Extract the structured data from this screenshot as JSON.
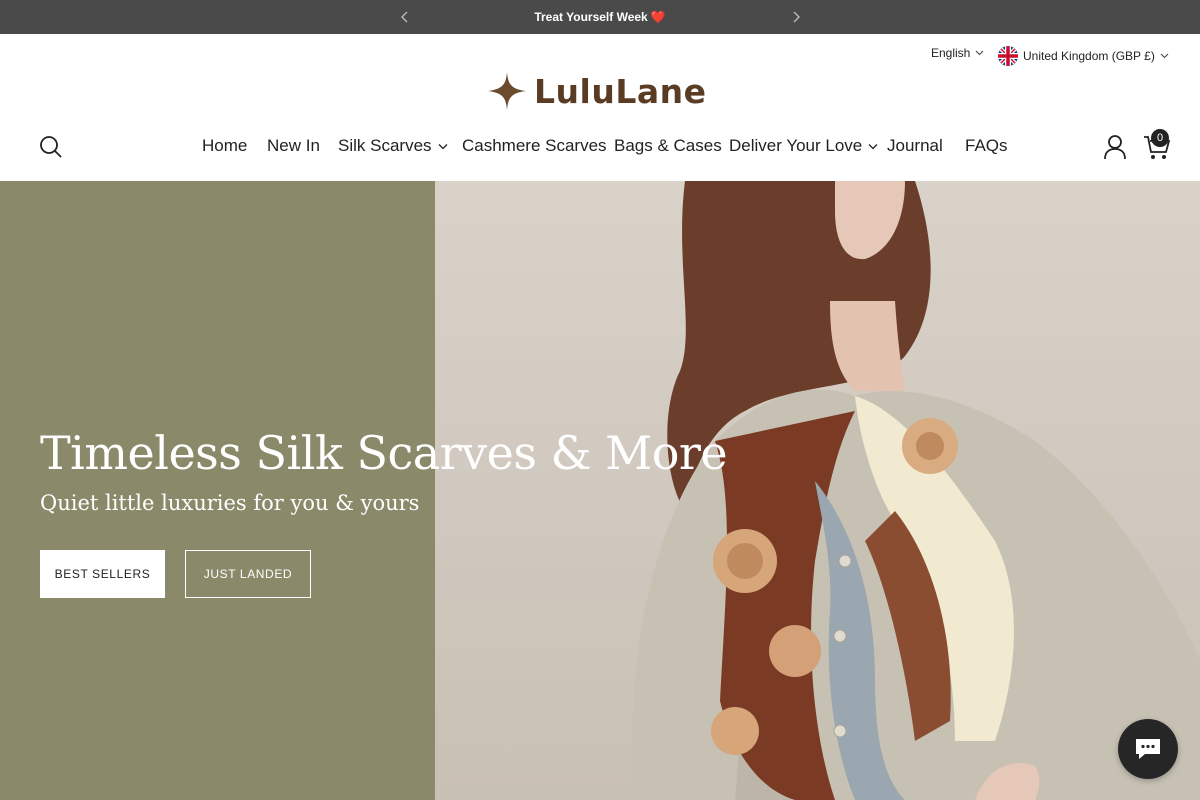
{
  "announcement": {
    "text": "Treat Yourself Week",
    "emoji": "❤️",
    "background": "#4a4a4a"
  },
  "header": {
    "language": "English",
    "country": "United Kingdom (GBP £)",
    "logo_text": "LuluLane",
    "logo_color": "#5a3c25",
    "cart_count": "0"
  },
  "nav": {
    "items": [
      {
        "label": "Home",
        "has_dropdown": false
      },
      {
        "label": "New In",
        "has_dropdown": false
      },
      {
        "label": "Silk Scarves",
        "has_dropdown": true
      },
      {
        "label": "Cashmere Scarves",
        "has_dropdown": false
      },
      {
        "label": "Bags & Cases",
        "has_dropdown": false
      },
      {
        "label": "Deliver Your Love",
        "has_dropdown": true
      },
      {
        "label": "Journal",
        "has_dropdown": false
      },
      {
        "label": "FAQs",
        "has_dropdown": false
      }
    ]
  },
  "hero": {
    "title": "Timeless Silk Scarves & More",
    "subtitle": "Quiet little luxuries for you & yours",
    "primary_button": "BEST SELLERS",
    "secondary_button": "JUST LANDED",
    "panel_color": "#8a8a6a"
  },
  "icons": {
    "search": "search-icon",
    "account": "user-icon",
    "cart": "cart-icon",
    "chat": "chat-icon",
    "prev": "chevron-left-icon",
    "next": "chevron-right-icon"
  }
}
